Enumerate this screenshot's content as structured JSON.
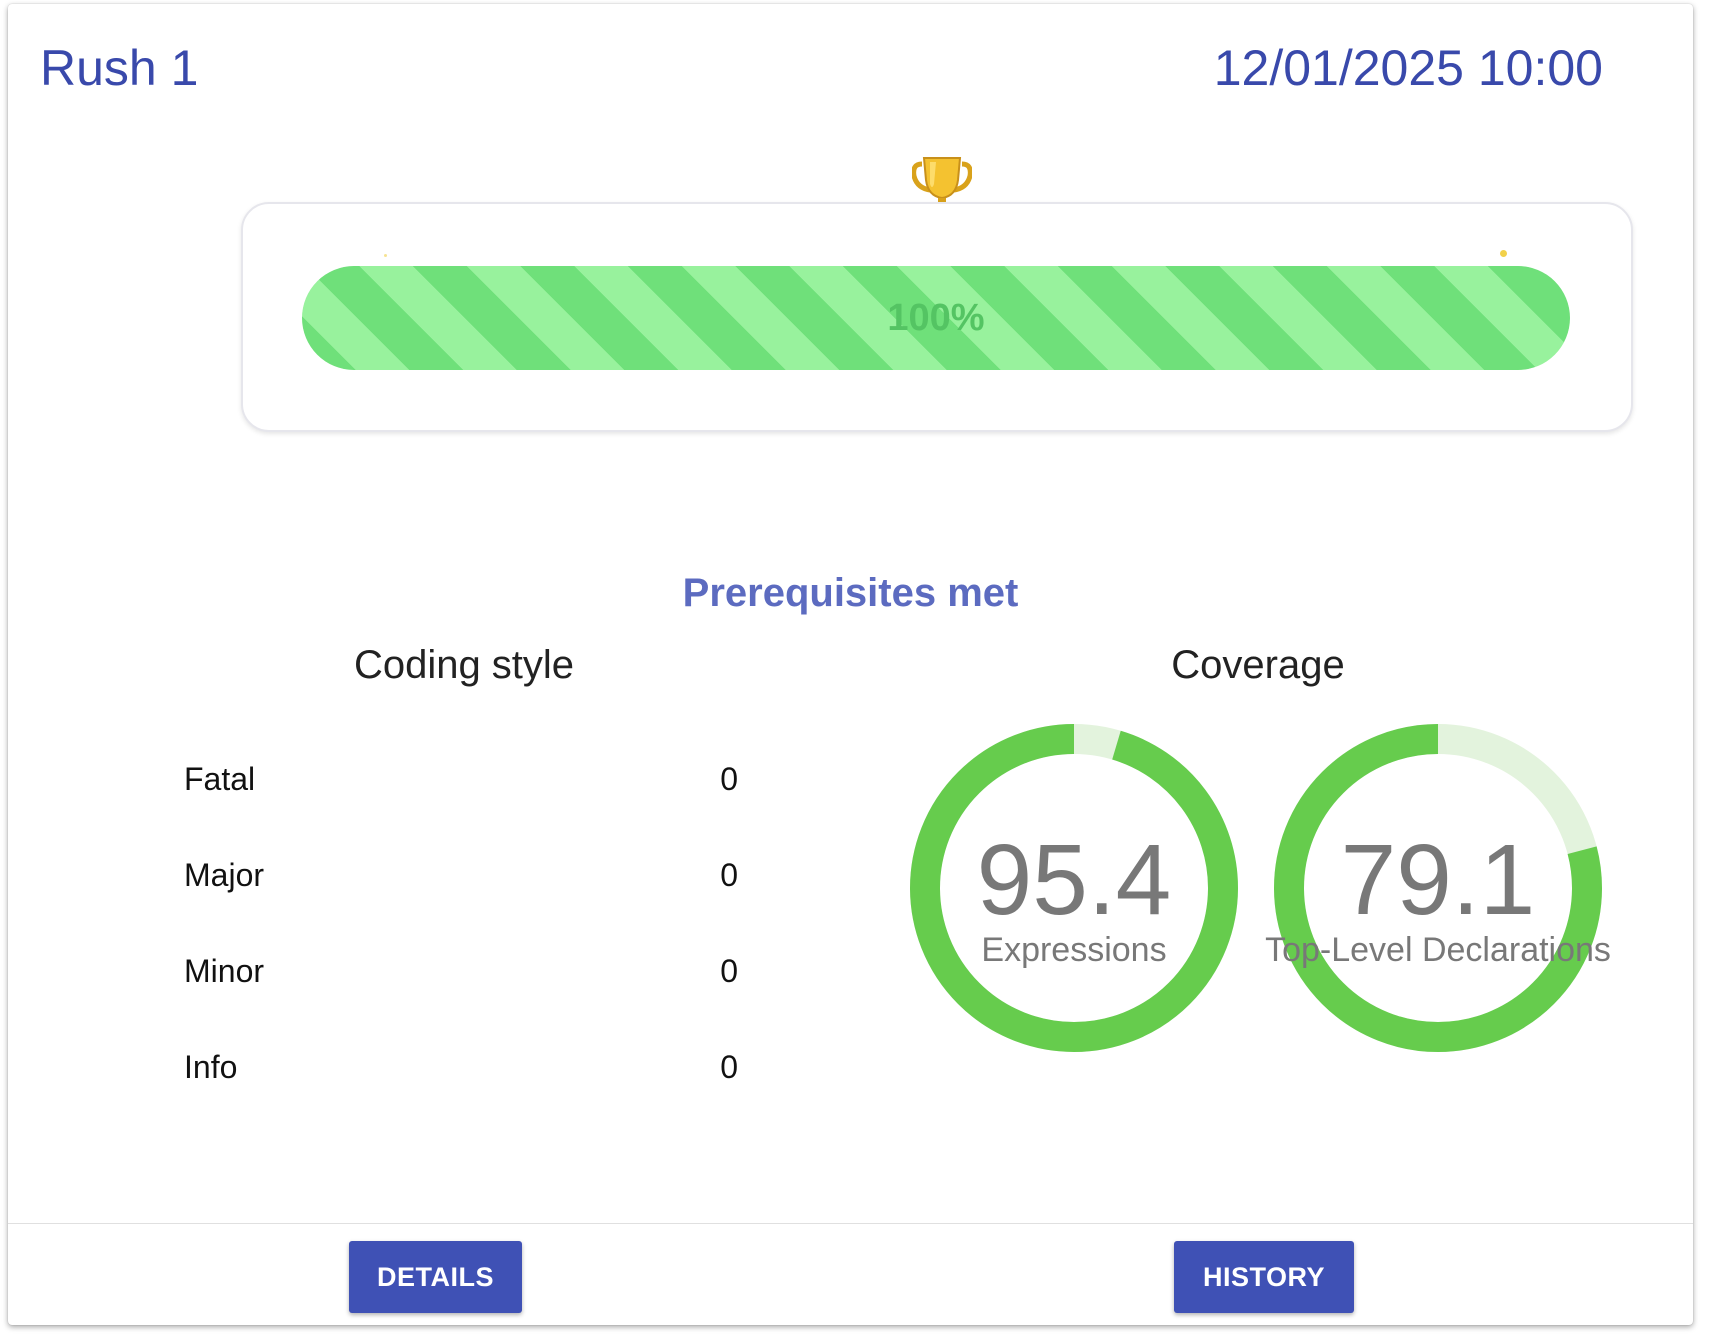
{
  "header": {
    "title": "Rush 1",
    "date": "12/01/2025 10:00"
  },
  "progress": {
    "value": 1.0,
    "label": "100%",
    "icon": "trophy-icon",
    "colors": {
      "stripe_dark": "#6fe07a",
      "stripe_light": "#98f29d",
      "label": "#54c463"
    }
  },
  "status": {
    "text": "Prerequisites met",
    "color": "#5c6bc0"
  },
  "coding_style": {
    "title": "Coding style",
    "rows": [
      {
        "label": "Fatal",
        "value": "0"
      },
      {
        "label": "Major",
        "value": "0"
      },
      {
        "label": "Minor",
        "value": "0"
      },
      {
        "label": "Info",
        "value": "0"
      }
    ]
  },
  "coverage": {
    "title": "Coverage",
    "gauges": [
      {
        "value": "95.4",
        "label": "Expressions",
        "percent": 95.4
      },
      {
        "value": "79.1",
        "label": "Top-Level Declarations",
        "percent": 79.1
      }
    ],
    "colors": {
      "filled": "#66cc4d",
      "track": "#e3f3dd"
    }
  },
  "actions": {
    "details_label": "DETAILS",
    "history_label": "HISTORY",
    "button_color": "#3f51b5"
  }
}
